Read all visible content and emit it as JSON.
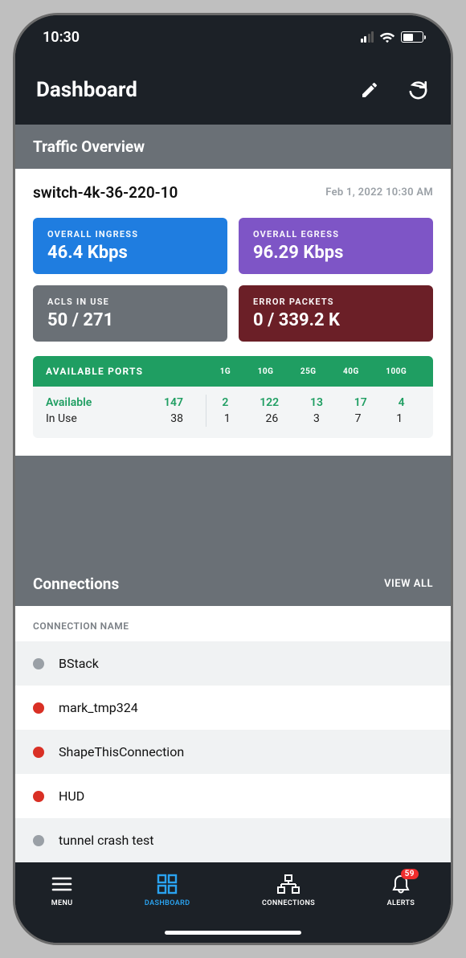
{
  "status": {
    "time": "10:30"
  },
  "header": {
    "title": "Dashboard"
  },
  "traffic": {
    "section_title": "Traffic Overview",
    "device_name": "switch-4k-36-220-10",
    "timestamp": "Feb 1, 2022 10:30 AM",
    "ingress": {
      "label": "OVERALL INGRESS",
      "value": "46.4 Kbps"
    },
    "egress": {
      "label": "OVERALL EGRESS",
      "value": "96.29 Kbps"
    },
    "acls": {
      "label": "ACLS IN USE",
      "value": "50 / 271"
    },
    "errors": {
      "label": "ERROR PACKETS",
      "value": "0 / 339.2 K"
    },
    "ports": {
      "head_title": "AVAILABLE PORTS",
      "columns": [
        "1G",
        "10G",
        "25G",
        "40G",
        "100G"
      ],
      "available_label": "Available",
      "available_total": "147",
      "inuse_label": "In Use",
      "inuse_total": "38",
      "available_by_speed": [
        "2",
        "122",
        "13",
        "17",
        "4"
      ],
      "inuse_by_speed": [
        "1",
        "26",
        "3",
        "7",
        "1"
      ]
    }
  },
  "connections": {
    "section_title": "Connections",
    "view_all": "VIEW ALL",
    "column_header": "CONNECTION NAME",
    "items": [
      {
        "name": "BStack",
        "status": "gray"
      },
      {
        "name": "mark_tmp324",
        "status": "red"
      },
      {
        "name": "ShapeThisConnection",
        "status": "red"
      },
      {
        "name": "HUD",
        "status": "red"
      },
      {
        "name": "tunnel crash test",
        "status": "gray"
      }
    ]
  },
  "nav": {
    "menu": "MENU",
    "dashboard": "DASHBOARD",
    "connections": "CONNECTIONS",
    "alerts": "ALERTS",
    "alerts_badge": "59"
  }
}
